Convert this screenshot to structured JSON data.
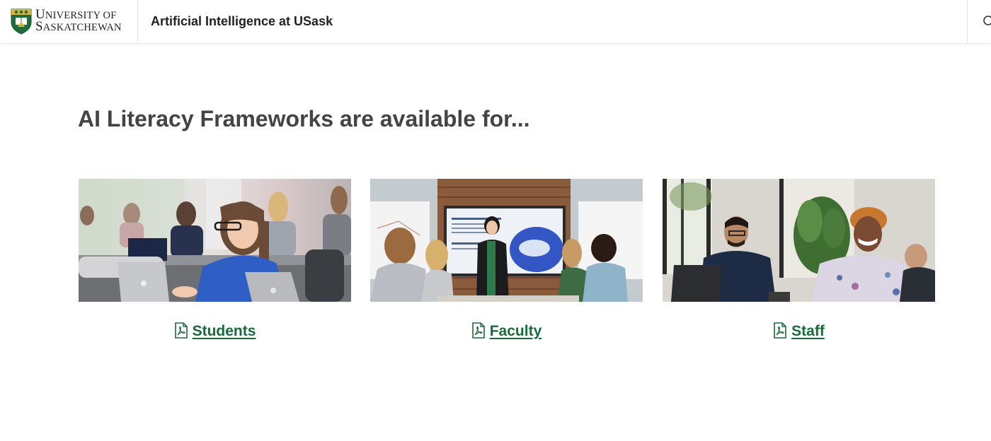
{
  "header": {
    "logo_line1_initial": "U",
    "logo_line1_rest": "NIVERSITY OF",
    "logo_line2_initial": "S",
    "logo_line2_rest": "ASKATCHEWAN",
    "site_title": "Artificial Intelligence at USask",
    "search_icon": "search-icon"
  },
  "main": {
    "heading": "AI Literacy Frameworks are available for...",
    "cards": [
      {
        "label": "Students",
        "icon": "pdf-icon",
        "image": "students-photo"
      },
      {
        "label": "Faculty",
        "icon": "pdf-icon",
        "image": "faculty-photo"
      },
      {
        "label": "Staff",
        "icon": "pdf-icon",
        "image": "staff-photo"
      }
    ]
  },
  "colors": {
    "link": "#1a6b3c",
    "heading": "#444444",
    "crest_green": "#1f6b3a",
    "crest_gold": "#d9b43a"
  }
}
